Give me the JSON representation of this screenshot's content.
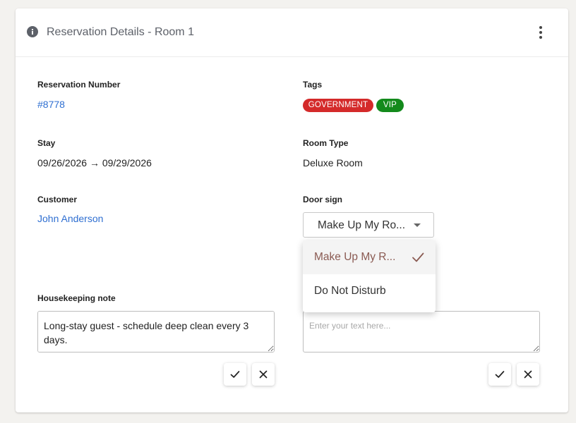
{
  "card": {
    "title": "Reservation Details - Room 1",
    "info_icon": "info-icon",
    "menu_icon": "kebab-menu-icon"
  },
  "reservation": {
    "label": "Reservation Number",
    "value": "#8778"
  },
  "tags": {
    "label": "Tags",
    "items": [
      {
        "text": "GOVERNMENT",
        "color": "#d42a2a"
      },
      {
        "text": "VIP",
        "color": "#138a1c"
      }
    ]
  },
  "stay": {
    "label": "Stay",
    "value": "09/26/2026 → 09/29/2026"
  },
  "room_type": {
    "label": "Room Type",
    "value": "Deluxe Room"
  },
  "customer": {
    "label": "Customer",
    "value": "John Anderson"
  },
  "door_sign": {
    "label": "Door sign",
    "selected": "Make Up My Ro...",
    "options": [
      {
        "label": "Make Up My R...",
        "selected": true
      },
      {
        "label": "Do Not Disturb",
        "selected": false
      }
    ]
  },
  "housekeeping": {
    "label": "Housekeeping note",
    "value": "Long-stay guest - schedule deep clean every 3 days."
  },
  "second_note": {
    "placeholder": "Enter your text here..."
  },
  "actions": {
    "confirm_icon": "check-icon",
    "cancel_icon": "close-icon"
  },
  "colors": {
    "link": "#2f6fd1",
    "selected_option": "#8a5a52"
  }
}
